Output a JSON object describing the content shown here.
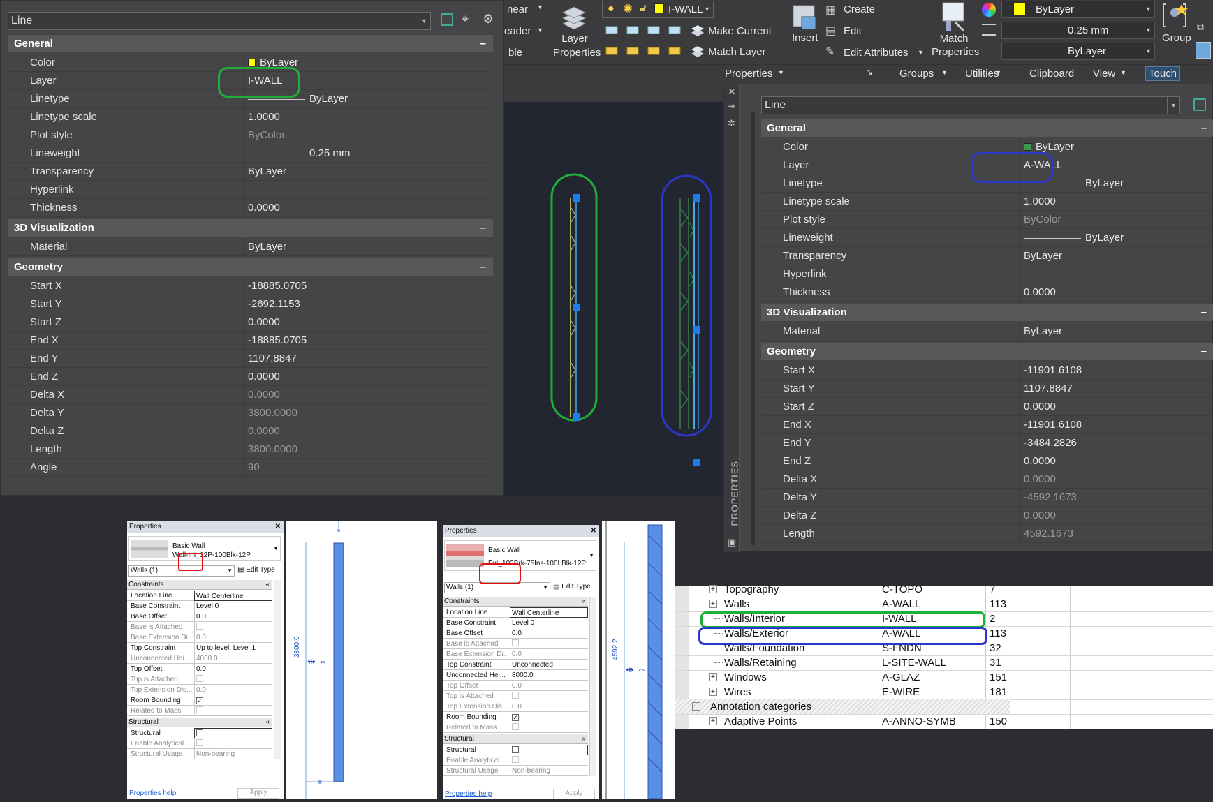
{
  "left_panel": {
    "type_select": "Line",
    "sections": {
      "general": "General",
      "viz": "3D Visualization",
      "geometry": "Geometry"
    },
    "general": [
      {
        "k": "Color",
        "v": "ByLayer",
        "swatch": "#ffff00"
      },
      {
        "k": "Layer",
        "v": "I-WALL"
      },
      {
        "k": "Linetype",
        "v": "ByLayer",
        "line": true
      },
      {
        "k": "Linetype scale",
        "v": "1.0000"
      },
      {
        "k": "Plot style",
        "v": "ByColor",
        "grey": true
      },
      {
        "k": "Lineweight",
        "v": "0.25 mm",
        "line": true
      },
      {
        "k": "Transparency",
        "v": "ByLayer"
      },
      {
        "k": "Hyperlink",
        "v": ""
      },
      {
        "k": "Thickness",
        "v": "0.0000"
      }
    ],
    "viz": [
      {
        "k": "Material",
        "v": "ByLayer"
      }
    ],
    "geometry": [
      {
        "k": "Start X",
        "v": "-18885.0705"
      },
      {
        "k": "Start Y",
        "v": "-2692.1153"
      },
      {
        "k": "Start Z",
        "v": "0.0000"
      },
      {
        "k": "End X",
        "v": "-18885.0705"
      },
      {
        "k": "End Y",
        "v": "1107.8847"
      },
      {
        "k": "End Z",
        "v": "0.0000"
      },
      {
        "k": "Delta X",
        "v": "0.0000",
        "grey": true
      },
      {
        "k": "Delta Y",
        "v": "3800.0000",
        "grey": true
      },
      {
        "k": "Delta Z",
        "v": "0.0000",
        "grey": true
      },
      {
        "k": "Length",
        "v": "3800.0000",
        "grey": true
      },
      {
        "k": "Angle",
        "v": "90",
        "grey": true
      }
    ]
  },
  "ribbon": {
    "partial1": "near",
    "partial2": "eader",
    "partial3": "ble",
    "layer_properties": "Layer\nProperties",
    "layer_combo": "I-WALL",
    "layer_combo_color": "#ffff00",
    "make_current": "Make Current",
    "match_layer": "Match Layer",
    "insert": "Insert",
    "create": "Create",
    "edit": "Edit",
    "edit_attributes": "Edit Attributes",
    "match_properties": "Match\nProperties",
    "color_combo": "ByLayer",
    "lineweight_combo": "0.25 mm",
    "linetype_combo": "ByLayer",
    "group": "Group",
    "tabs": [
      "Properties",
      "Groups",
      "Utilities",
      "Clipboard",
      "View",
      "Touch"
    ]
  },
  "right_panel": {
    "side_label": "PROPERTIES",
    "type_select": "Line",
    "sections": {
      "general": "General",
      "viz": "3D Visualization",
      "geometry": "Geometry"
    },
    "general": [
      {
        "k": "Color",
        "v": "ByLayer",
        "swatch": "#3a9a4a"
      },
      {
        "k": "Layer",
        "v": "A-WALL"
      },
      {
        "k": "Linetype",
        "v": "ByLayer",
        "line": true
      },
      {
        "k": "Linetype scale",
        "v": "1.0000"
      },
      {
        "k": "Plot style",
        "v": "ByColor",
        "grey": true
      },
      {
        "k": "Lineweight",
        "v": "ByLayer",
        "line": true
      },
      {
        "k": "Transparency",
        "v": "ByLayer"
      },
      {
        "k": "Hyperlink",
        "v": ""
      },
      {
        "k": "Thickness",
        "v": "0.0000"
      }
    ],
    "viz": [
      {
        "k": "Material",
        "v": "ByLayer"
      }
    ],
    "geometry": [
      {
        "k": "Start X",
        "v": "-11901.6108"
      },
      {
        "k": "Start Y",
        "v": "1107.8847"
      },
      {
        "k": "Start Z",
        "v": "0.0000"
      },
      {
        "k": "End X",
        "v": "-11901.6108"
      },
      {
        "k": "End Y",
        "v": "-3484.2826"
      },
      {
        "k": "End Z",
        "v": "0.0000"
      },
      {
        "k": "Delta X",
        "v": "0.0000",
        "grey": true
      },
      {
        "k": "Delta Y",
        "v": "-4592.1673",
        "grey": true
      },
      {
        "k": "Delta Z",
        "v": "0.0000",
        "grey": true
      },
      {
        "k": "Length",
        "v": "4592.1673",
        "grey": true
      }
    ]
  },
  "revit1": {
    "title": "Properties",
    "family": "Basic Wall",
    "type": "Wall-Int_12P-100Blk-12P",
    "instance": "Walls (1)",
    "edit_type": "Edit Type",
    "sec_constraints": "Constraints",
    "sec_structural": "Structural",
    "rows": [
      {
        "k": "Location Line",
        "v": "Wall Centerline"
      },
      {
        "k": "Base Constraint",
        "v": "Level 0"
      },
      {
        "k": "Base Offset",
        "v": "0.0"
      },
      {
        "k": "Base is Attached",
        "v": "",
        "cb": "dim",
        "grey": true
      },
      {
        "k": "Base Extension Di...",
        "v": "0.0",
        "grey": true
      },
      {
        "k": "Top Constraint",
        "v": "Up to level: Level 1"
      },
      {
        "k": "Unconnected Hei...",
        "v": "4000.0",
        "grey": true
      },
      {
        "k": "Top Offset",
        "v": "0.0"
      },
      {
        "k": "Top is Attached",
        "v": "",
        "cb": "dim",
        "grey": true
      },
      {
        "k": "Top Extension Dis...",
        "v": "0.0",
        "grey": true
      },
      {
        "k": "Room Bounding",
        "v": "",
        "cb": "on"
      },
      {
        "k": "Related to Mass",
        "v": "",
        "cb": "dim",
        "grey": true
      }
    ],
    "struct_rows": [
      {
        "k": "Structural",
        "v": "",
        "cb": "off"
      },
      {
        "k": "Enable Analytical ...",
        "v": "",
        "cb": "dim",
        "grey": true
      },
      {
        "k": "Structural Usage",
        "v": "Non-bearing",
        "grey": true
      }
    ],
    "help": "Properties help",
    "apply": "Apply",
    "dim": "3800.0"
  },
  "revit2": {
    "title": "Properties",
    "family": "Basic Wall",
    "type": "Ext_102Brk-75Ins-100LBlk-12P",
    "instance": "Walls (1)",
    "edit_type": "Edit Type",
    "sec_constraints": "Constraints",
    "sec_structural": "Structural",
    "rows": [
      {
        "k": "Location Line",
        "v": "Wall Centerline"
      },
      {
        "k": "Base Constraint",
        "v": "Level 0"
      },
      {
        "k": "Base Offset",
        "v": "0.0"
      },
      {
        "k": "Base is Attached",
        "v": "",
        "cb": "dim",
        "grey": true
      },
      {
        "k": "Base Extension Di...",
        "v": "0.0",
        "grey": true
      },
      {
        "k": "Top Constraint",
        "v": "Unconnected"
      },
      {
        "k": "Unconnected Hei...",
        "v": "8000.0"
      },
      {
        "k": "Top Offset",
        "v": "0.0",
        "grey": true
      },
      {
        "k": "Top is Attached",
        "v": "",
        "cb": "dim",
        "grey": true
      },
      {
        "k": "Top Extension Dis...",
        "v": "0.0",
        "grey": true
      },
      {
        "k": "Room Bounding",
        "v": "",
        "cb": "on"
      },
      {
        "k": "Related to Mass",
        "v": "",
        "cb": "dim",
        "grey": true
      }
    ],
    "struct_rows": [
      {
        "k": "Structural",
        "v": "",
        "cb": "off"
      },
      {
        "k": "Enable Analytical ...",
        "v": "",
        "cb": "dim",
        "grey": true
      },
      {
        "k": "Structural Usage",
        "v": "Non-bearing",
        "grey": true
      }
    ],
    "help": "Properties help",
    "apply": "Apply",
    "dim": "4592.2"
  },
  "layer_table": {
    "rows": [
      {
        "name": "Topography",
        "layer": "C-TOPO",
        "count": "7",
        "plus": true
      },
      {
        "name": "Walls",
        "layer": "A-WALL",
        "count": "113",
        "plus": true
      },
      {
        "name": "Walls/Interior",
        "layer": "I-WALL",
        "count": "2"
      },
      {
        "name": "Walls/Exterior",
        "layer": "A-WALL",
        "count": "113"
      },
      {
        "name": "Walls/Foundation",
        "layer": "S-FNDN",
        "count": "32"
      },
      {
        "name": "Walls/Retaining",
        "layer": "L-SITE-WALL",
        "count": "31"
      },
      {
        "name": "Windows",
        "layer": "A-GLAZ",
        "count": "151",
        "plus": true
      },
      {
        "name": "Wires",
        "layer": "E-WIRE",
        "count": "181",
        "plus": true
      },
      {
        "name": "Annotation categories",
        "layer": "",
        "count": "",
        "minus": true
      },
      {
        "name": "Adaptive Points",
        "layer": "A-ANNO-SYMB",
        "count": "150",
        "plus": true
      }
    ]
  },
  "colors": {
    "green": "#1fae3a",
    "blue": "#2b37c8",
    "red": "#e01010"
  }
}
